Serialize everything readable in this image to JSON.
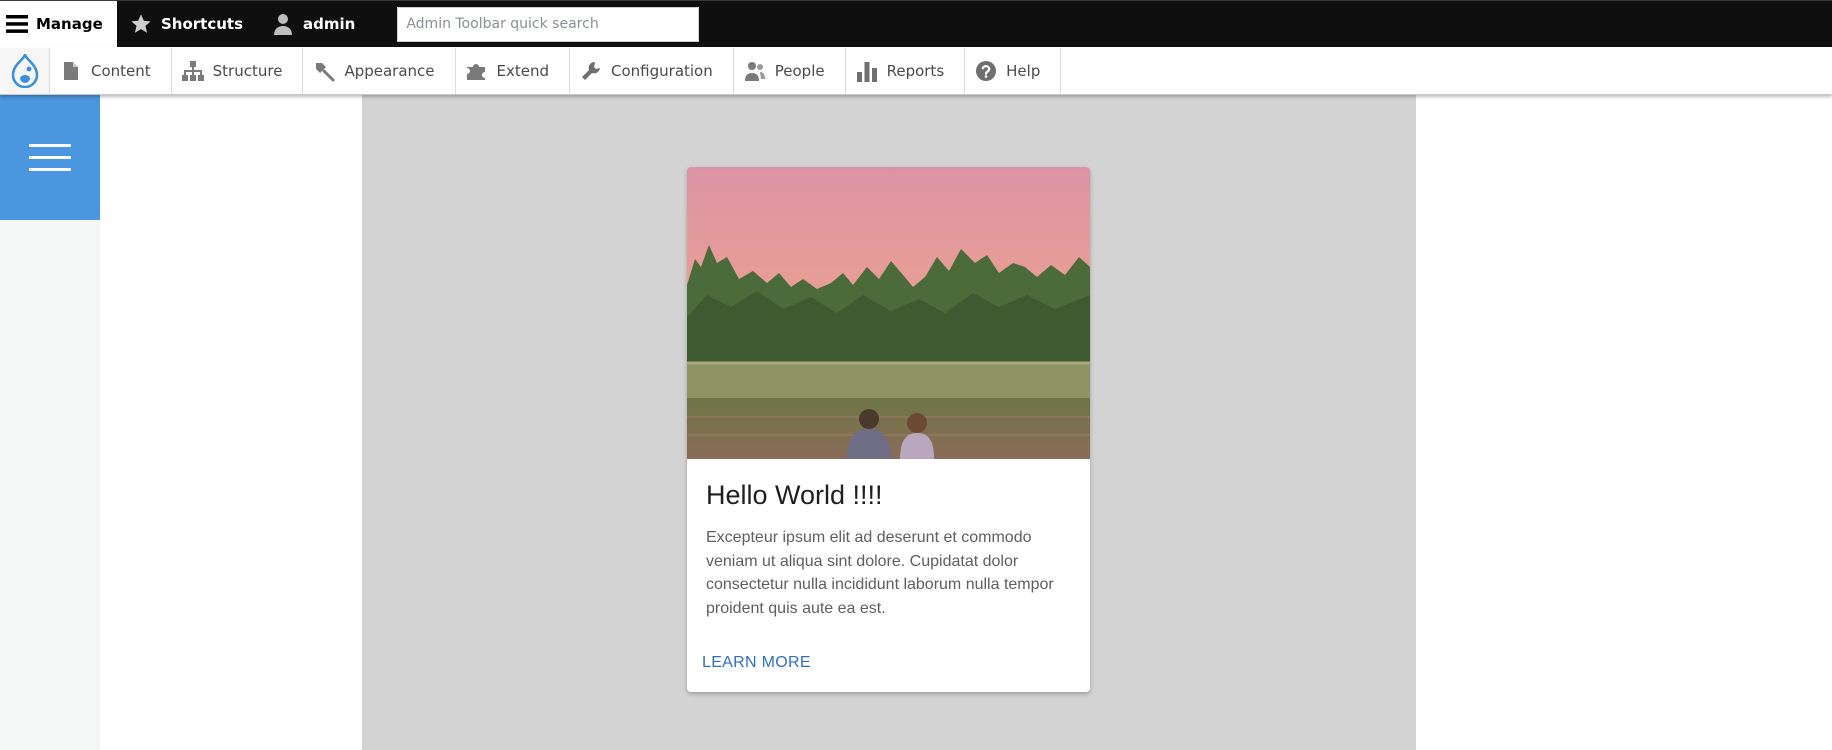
{
  "toolbar": {
    "manage_label": "Manage",
    "shortcuts_label": "Shortcuts",
    "user_label": "admin",
    "search_placeholder": "Admin Toolbar quick search"
  },
  "admin_menu": {
    "items": [
      {
        "label": "Content",
        "icon": "file-icon"
      },
      {
        "label": "Structure",
        "icon": "sitemap-icon"
      },
      {
        "label": "Appearance",
        "icon": "paintbrush-icon"
      },
      {
        "label": "Extend",
        "icon": "puzzle-icon"
      },
      {
        "label": "Configuration",
        "icon": "wrench-icon"
      },
      {
        "label": "People",
        "icon": "people-icon"
      },
      {
        "label": "Reports",
        "icon": "bar-chart-icon"
      },
      {
        "label": "Help",
        "icon": "help-icon"
      }
    ]
  },
  "sidebar": {
    "toggle_icon": "hamburger-icon"
  },
  "colors": {
    "toolbar_bg": "#0f0f0f",
    "accent_blue": "#4a97df",
    "stage_bg": "#d3d3d3",
    "link_blue": "#2f6fc6"
  },
  "card": {
    "title": "Hello World !!!!",
    "body": "Excepteur ipsum elit ad deserunt et commodo veniam ut aliqua sint dolore. Cupidatat dolor consectetur nulla incididunt laborum nulla tempor proident quis aute ea est.",
    "link_label": "LEARN MORE"
  }
}
